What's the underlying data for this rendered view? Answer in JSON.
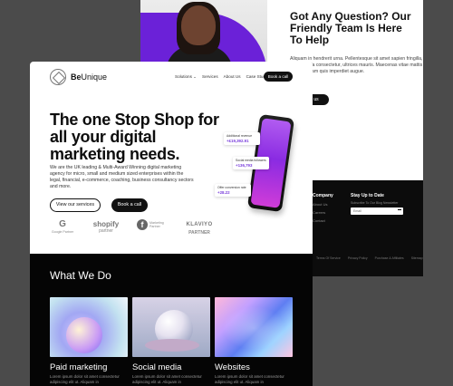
{
  "back_page": {
    "title": "Got Any Question? Our Friendly Team Is Here To Help",
    "paragraph": "Aliquam in hendrerit urna. Pellentesque sit amet sapien fringilla, mattis ligula consectetur, ultrices mauris. Maecenas vitae mattis tellus. Nullam quis imperdiet augue.",
    "button_label": "us",
    "footer": {
      "company_heading": "Company",
      "company_links": [
        "About Us",
        "Careers",
        "Contact"
      ],
      "newsletter_heading": "Stay Up to Date",
      "newsletter_sub": "Subscribe To Our Blog Newsletter",
      "email_placeholder": "Email",
      "bottom_links": [
        "Terms Of Service",
        "Privacy Policy",
        "Purchase & Affiliates",
        "Sitemap"
      ]
    }
  },
  "nav": {
    "brand_bold": "Be",
    "brand_rest": "Unique",
    "links": [
      "Solutions ⌄",
      "Services",
      "About Us",
      "Case Studies"
    ],
    "book_label": "Book a call"
  },
  "hero": {
    "title": "The one Stop Shop for all your digital marketing needs.",
    "paragraph": "We are the UK leading & Multi-Award Winning digital marketing agency for micro, small and medium sized enterprises within the legal, financial, e-commerce, coaching, business consultancy sectors and more.",
    "services_label": "View our services",
    "book_label": "Book a call"
  },
  "partners": [
    {
      "mark": "G",
      "caption": "Google Partner"
    },
    {
      "mark": "shopify",
      "caption": "partner"
    },
    {
      "mark": "f",
      "caption": "Marketing Partner"
    },
    {
      "mark": "KLAVIYO",
      "caption": "PARTNER"
    }
  ],
  "phone_cards": [
    {
      "label": "Additional revenue",
      "value": "+£19,392.91"
    },
    {
      "label": "Social media followers",
      "value": "+136,793"
    },
    {
      "label": "Offer conversion rate",
      "value": "+28.22"
    }
  ],
  "what_we_do": {
    "title": "What We Do",
    "tiles": [
      {
        "label": "Paid marketing",
        "text": "Lorem ipsum dolor sit amet consectetur adipiscing elit ut. Aliquam in"
      },
      {
        "label": "Social media",
        "text": "Lorem ipsum dolor sit amet consectetur adipiscing elit ut. Aliquam in"
      },
      {
        "label": "Websites",
        "text": "Lorem ipsum dolor sit amet consectetur adipiscing elit ut. Aliquam in"
      }
    ]
  },
  "colors": {
    "accent_purple": "#6b21d8",
    "dark": "#050505",
    "button_black": "#111111"
  }
}
